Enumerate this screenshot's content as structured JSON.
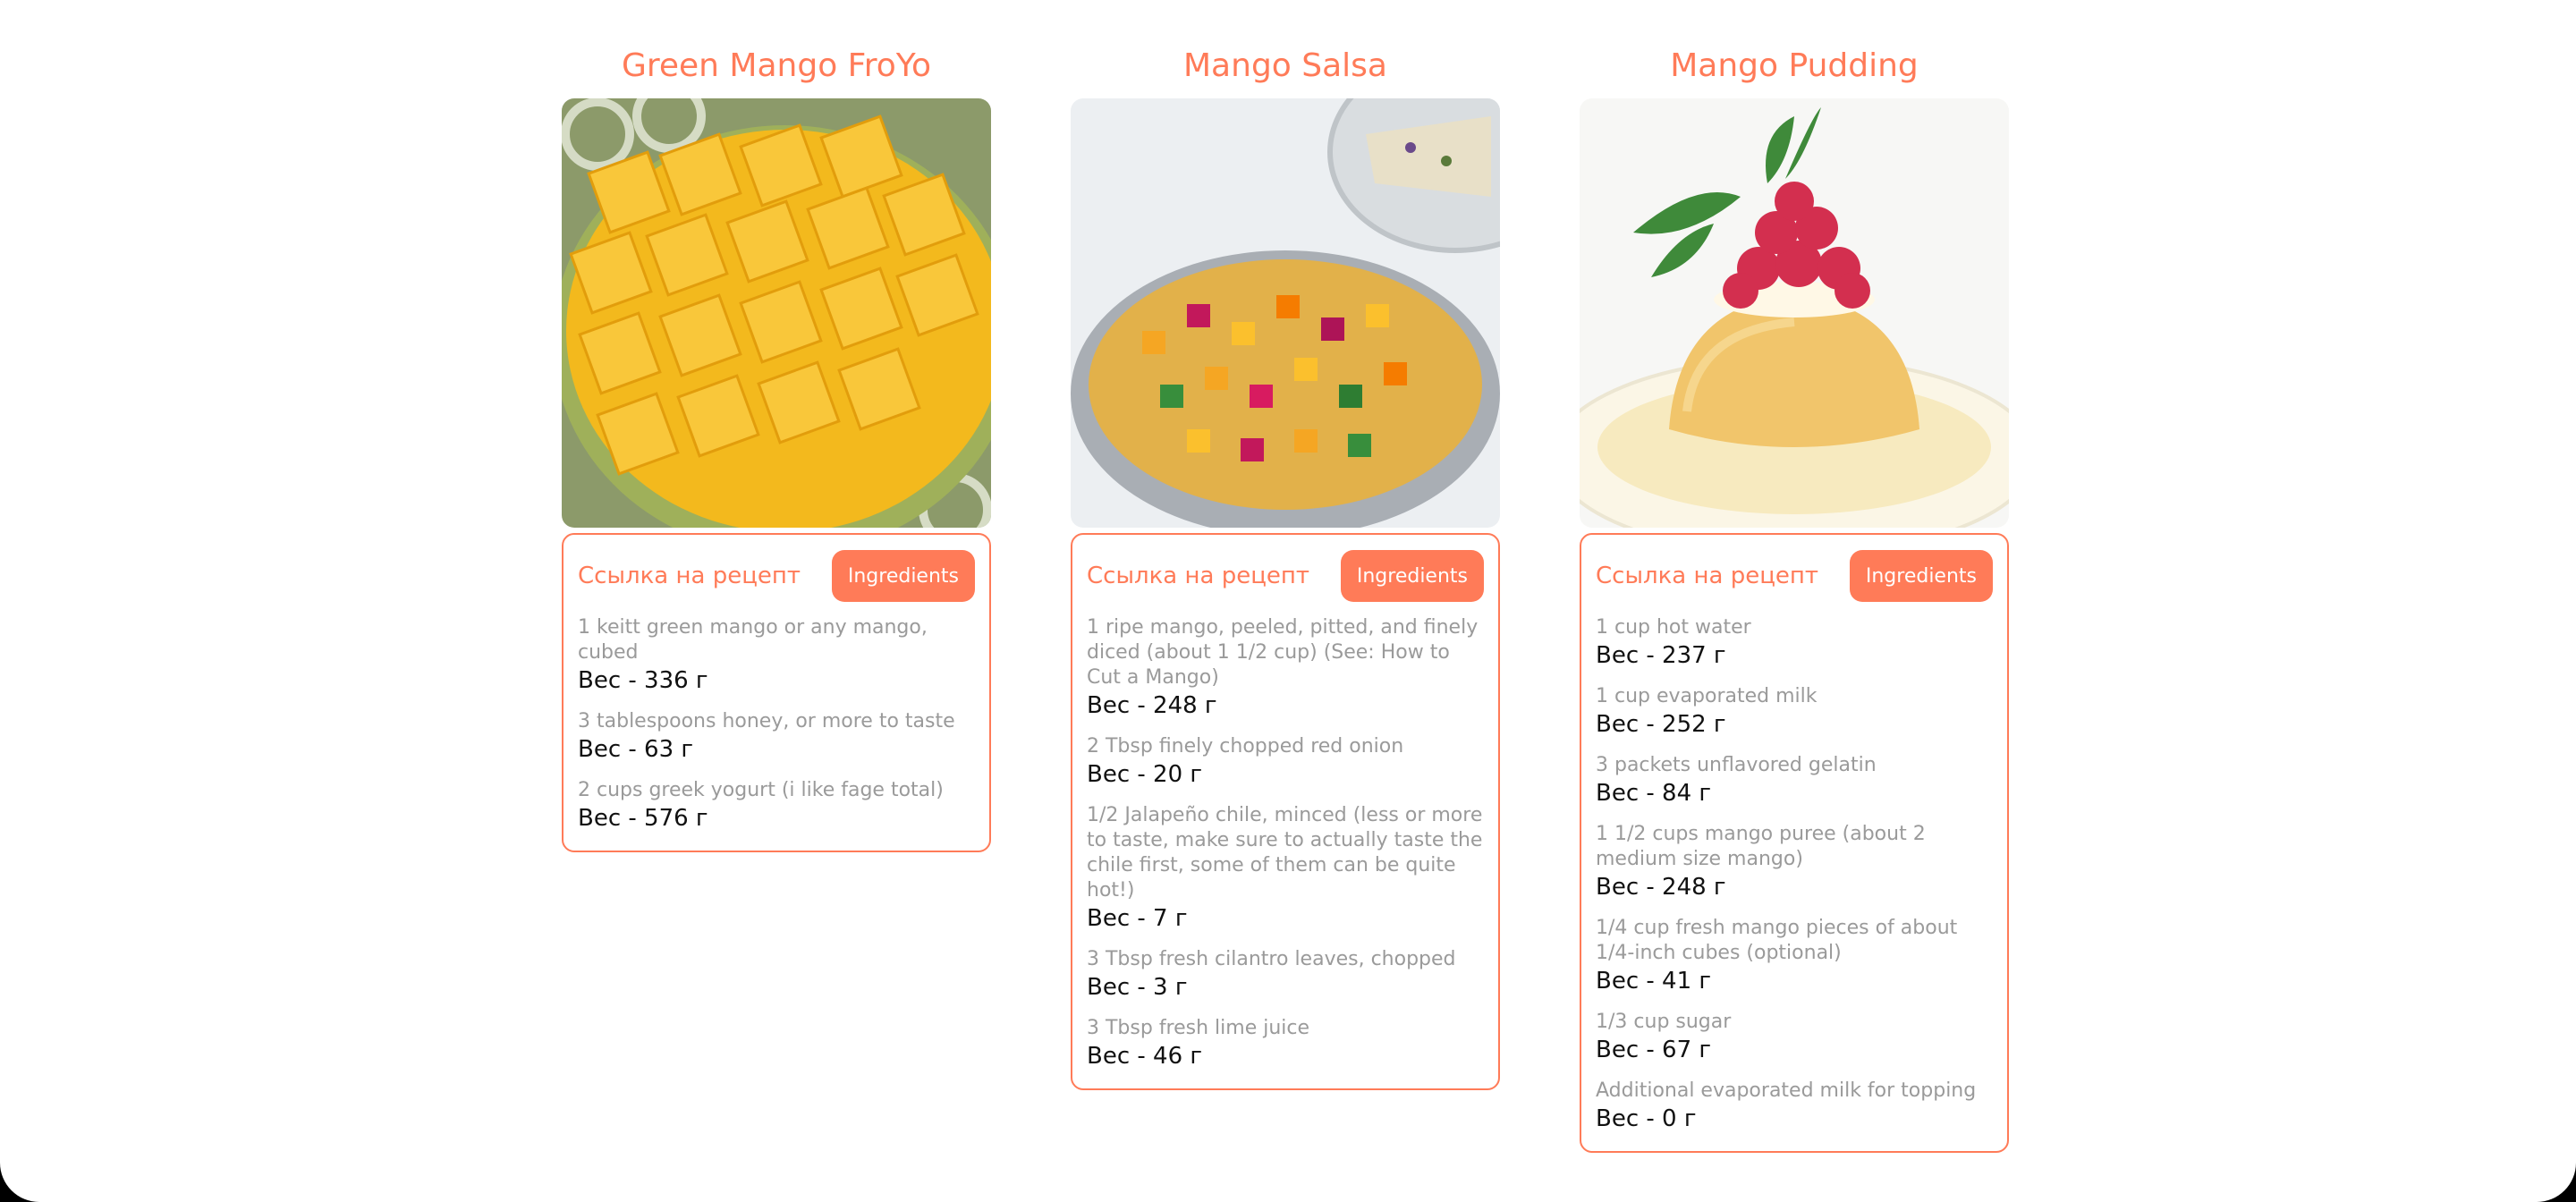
{
  "recipes": [
    {
      "title": "Green Mango FroYo",
      "link_label": "Ссылка на рецепт",
      "button_label": "Ingredients",
      "ingredients": [
        {
          "name": "1 keitt green mango or any mango, cubed",
          "weight": "Вес - 336 г"
        },
        {
          "name": "3 tablespoons honey, or more to taste",
          "weight": "Вес - 63 г"
        },
        {
          "name": "2 cups greek yogurt (i like fage total)",
          "weight": "Вес - 576 г"
        }
      ]
    },
    {
      "title": "Mango Salsa",
      "link_label": "Ссылка на рецепт",
      "button_label": "Ingredients",
      "ingredients": [
        {
          "name": "1 ripe mango, peeled, pitted, and finely diced (about 1 1/2 cup) (See: How to Cut a Mango)",
          "weight": "Вес - 248 г"
        },
        {
          "name": "2 Tbsp finely chopped red onion",
          "weight": "Вес - 20 г"
        },
        {
          "name": "1/2 Jalapeño chile, minced (less or more to taste, make sure to actually taste the chile first, some of them can be quite hot!)",
          "weight": "Вес - 7 г"
        },
        {
          "name": "3 Tbsp fresh cilantro leaves, chopped",
          "weight": "Вес - 3 г"
        },
        {
          "name": "3 Tbsp fresh lime juice",
          "weight": "Вес - 46 г"
        }
      ]
    },
    {
      "title": "Mango Pudding",
      "link_label": "Ссылка на рецепт",
      "button_label": "Ingredients",
      "ingredients": [
        {
          "name": "1 cup hot water",
          "weight": "Вес - 237 г"
        },
        {
          "name": "1 cup evaporated milk",
          "weight": "Вес - 252 г"
        },
        {
          "name": "3 packets unflavored gelatin",
          "weight": "Вес - 84 г"
        },
        {
          "name": "1 1/2 cups mango puree (about 2 medium size mango)",
          "weight": "Вес - 248 г"
        },
        {
          "name": "1/4 cup fresh mango pieces of about 1/4-inch cubes (optional)",
          "weight": "Вес - 41 г"
        },
        {
          "name": "1/3 cup sugar",
          "weight": "Вес - 67 г"
        },
        {
          "name": "Additional evaporated milk for topping",
          "weight": "Вес - 0 г"
        }
      ]
    }
  ],
  "colors": {
    "accent": "#ff7b58",
    "muted_text": "#9a9a9a",
    "weight_text": "#111111"
  }
}
